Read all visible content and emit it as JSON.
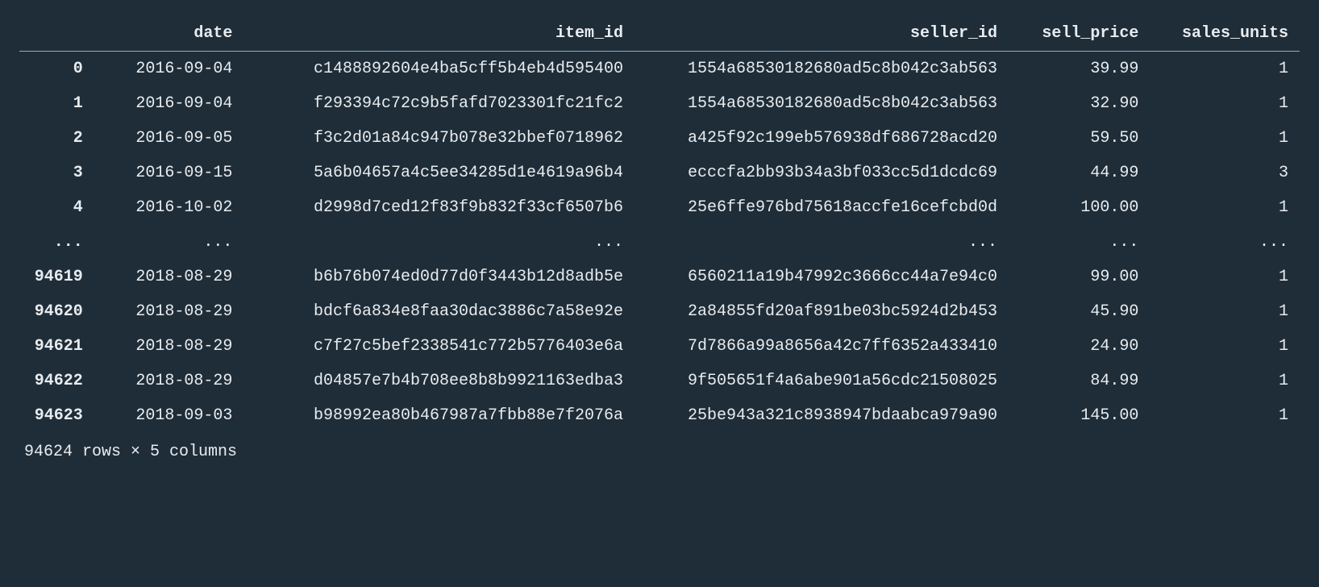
{
  "columns": [
    "date",
    "item_id",
    "seller_id",
    "sell_price",
    "sales_units"
  ],
  "rows": [
    {
      "index": "0",
      "date": "2016-09-04",
      "item_id": "c1488892604e4ba5cff5b4eb4d595400",
      "seller_id": "1554a68530182680ad5c8b042c3ab563",
      "sell_price": "39.99",
      "sales_units": "1"
    },
    {
      "index": "1",
      "date": "2016-09-04",
      "item_id": "f293394c72c9b5fafd7023301fc21fc2",
      "seller_id": "1554a68530182680ad5c8b042c3ab563",
      "sell_price": "32.90",
      "sales_units": "1"
    },
    {
      "index": "2",
      "date": "2016-09-05",
      "item_id": "f3c2d01a84c947b078e32bbef0718962",
      "seller_id": "a425f92c199eb576938df686728acd20",
      "sell_price": "59.50",
      "sales_units": "1"
    },
    {
      "index": "3",
      "date": "2016-09-15",
      "item_id": "5a6b04657a4c5ee34285d1e4619a96b4",
      "seller_id": "ecccfa2bb93b34a3bf033cc5d1dcdc69",
      "sell_price": "44.99",
      "sales_units": "3"
    },
    {
      "index": "4",
      "date": "2016-10-02",
      "item_id": "d2998d7ced12f83f9b832f33cf6507b6",
      "seller_id": "25e6ffe976bd75618accfe16cefcbd0d",
      "sell_price": "100.00",
      "sales_units": "1"
    },
    {
      "index": "...",
      "date": "...",
      "item_id": "...",
      "seller_id": "...",
      "sell_price": "...",
      "sales_units": "..."
    },
    {
      "index": "94619",
      "date": "2018-08-29",
      "item_id": "b6b76b074ed0d77d0f3443b12d8adb5e",
      "seller_id": "6560211a19b47992c3666cc44a7e94c0",
      "sell_price": "99.00",
      "sales_units": "1"
    },
    {
      "index": "94620",
      "date": "2018-08-29",
      "item_id": "bdcf6a834e8faa30dac3886c7a58e92e",
      "seller_id": "2a84855fd20af891be03bc5924d2b453",
      "sell_price": "45.90",
      "sales_units": "1"
    },
    {
      "index": "94621",
      "date": "2018-08-29",
      "item_id": "c7f27c5bef2338541c772b5776403e6a",
      "seller_id": "7d7866a99a8656a42c7ff6352a433410",
      "sell_price": "24.90",
      "sales_units": "1"
    },
    {
      "index": "94622",
      "date": "2018-08-29",
      "item_id": "d04857e7b4b708ee8b8b9921163edba3",
      "seller_id": "9f505651f4a6abe901a56cdc21508025",
      "sell_price": "84.99",
      "sales_units": "1"
    },
    {
      "index": "94623",
      "date": "2018-09-03",
      "item_id": "b98992ea80b467987a7fbb88e7f2076a",
      "seller_id": "25be943a321c8938947bdaabca979a90",
      "sell_price": "145.00",
      "sales_units": "1"
    }
  ],
  "summary": "94624 rows × 5 columns"
}
